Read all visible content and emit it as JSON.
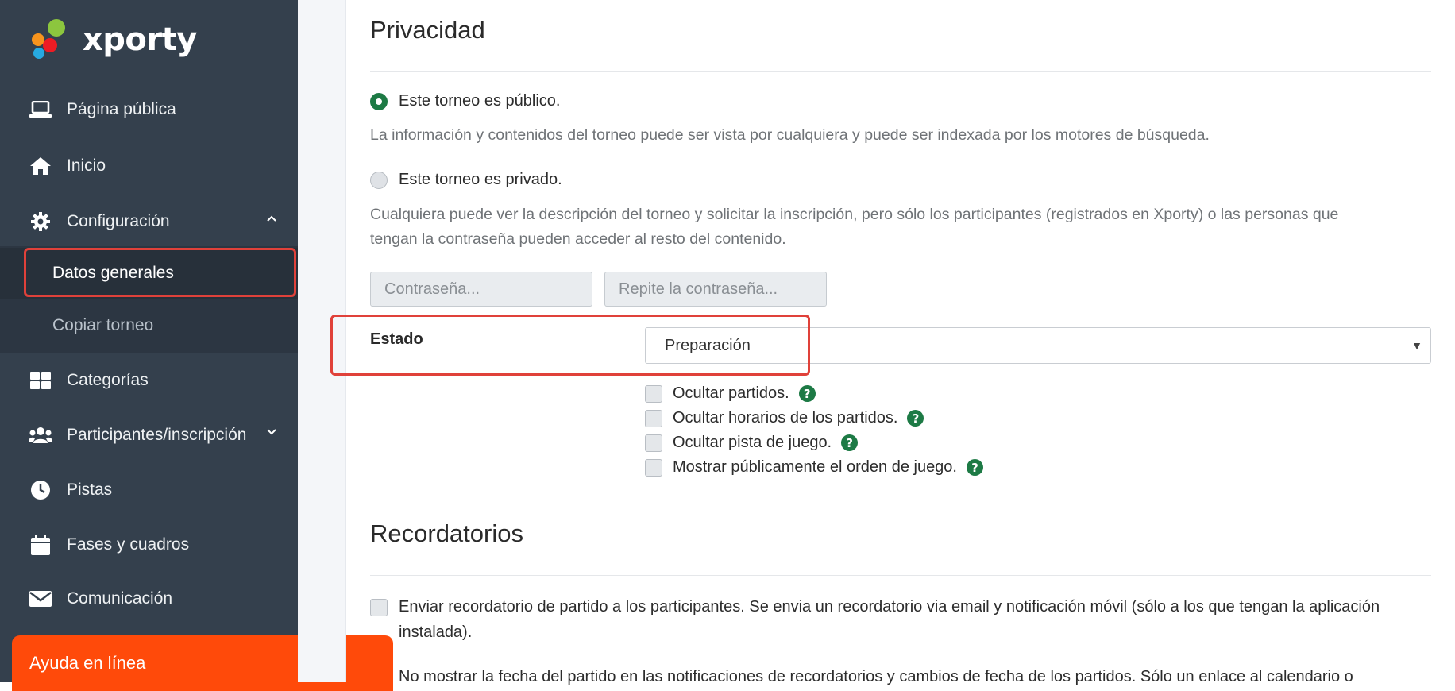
{
  "brand": {
    "name": "xporty"
  },
  "sidebar": {
    "items": [
      {
        "label": "Página pública",
        "icon": "laptop-icon"
      },
      {
        "label": "Inicio",
        "icon": "home-icon"
      },
      {
        "label": "Configuración",
        "icon": "gear-icon"
      },
      {
        "label": "Categorías",
        "icon": "grid-icon"
      },
      {
        "label": "Participantes/inscripción",
        "icon": "users-icon"
      },
      {
        "label": "Pistas",
        "icon": "clock-icon"
      },
      {
        "label": "Fases y cuadros",
        "icon": "calendar-icon"
      },
      {
        "label": "Comunicación",
        "icon": "envelope-icon"
      }
    ],
    "subitems": [
      {
        "label": "Datos generales",
        "active": true
      },
      {
        "label": "Copiar torneo",
        "active": false
      }
    ],
    "help_label": "Ayuda en línea"
  },
  "privacy": {
    "title": "Privacidad",
    "public_option": "Este torneo es público.",
    "public_desc": "La información y contenidos del torneo puede ser vista por cualquiera y puede ser indexada por los motores de búsqueda.",
    "private_option": "Este torneo es privado.",
    "private_desc_line1": "Cualquiera puede ver la descripción del torneo y solicitar la inscripción, pero sólo los participantes (registrados en Xporty) o las personas que",
    "private_desc_line2": "tengan la contraseña pueden acceder al resto del contenido.",
    "password_placeholder": "Contraseña...",
    "password_repeat_placeholder": "Repite la contraseña...",
    "selected": "public"
  },
  "estado": {
    "label": "Estado",
    "value": "Preparación",
    "options": [
      {
        "label": "Ocultar partidos.",
        "checked": false
      },
      {
        "label": "Ocultar horarios de los partidos.",
        "checked": false
      },
      {
        "label": "Ocultar pista de juego.",
        "checked": false
      },
      {
        "label": "Mostrar públicamente el orden de juego.",
        "checked": false
      }
    ]
  },
  "reminders": {
    "title": "Recordatorios",
    "send_line1": "Enviar recordatorio de partido a los participantes. Se envia un recordatorio via email y notificación móvil (sólo a los que tengan la aplicación",
    "send_line2": "instalada).",
    "no_date_line": "No mostrar la fecha del partido en las notificaciones de recordatorios y cambios de fecha de los partidos. Sólo un enlace al calendario o"
  },
  "colors": {
    "sidebar": "#34404d",
    "accent_green": "#1d7a45",
    "help_orange": "#ff4a0a",
    "highlight_red": "#e0413a"
  }
}
